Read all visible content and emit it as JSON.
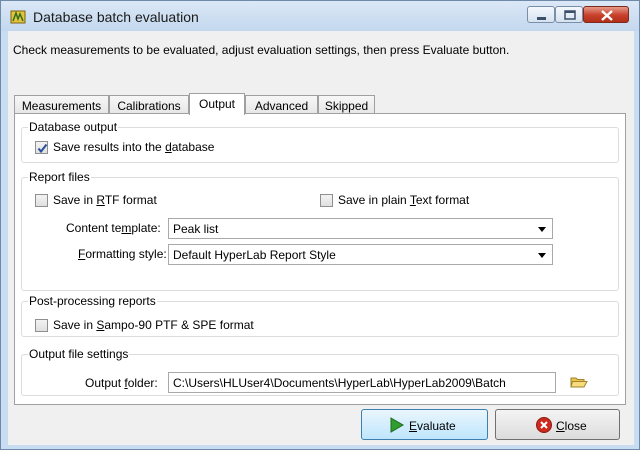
{
  "window": {
    "title": "Database batch evaluation",
    "instructions": "Check measurements to be evaluated, adjust evaluation settings, then press Evaluate button."
  },
  "tabs": [
    {
      "label": "Measurements",
      "active": false
    },
    {
      "label": "Calibrations",
      "active": false
    },
    {
      "label": "Output",
      "active": true
    },
    {
      "label": "Advanced",
      "active": false
    },
    {
      "label": "Skipped",
      "active": false
    }
  ],
  "database_output": {
    "group_label": "Database output",
    "save_results": {
      "pre": "Save results into the ",
      "accel": "d",
      "post": "atabase",
      "checked": true
    }
  },
  "report_files": {
    "group_label": "Report files",
    "save_rtf": {
      "pre": "Save in ",
      "accel": "R",
      "post": "TF format",
      "checked": false
    },
    "save_text": {
      "pre": "Save in plain ",
      "accel": "T",
      "post": "ext format",
      "checked": false
    },
    "content_template_label": {
      "pre": "Content te",
      "accel": "m",
      "post": "plate:"
    },
    "content_template_value": "Peak list",
    "formatting_style_label": {
      "pre": "",
      "accel": "F",
      "post": "ormatting style:"
    },
    "formatting_style_value": "Default HyperLab Report Style"
  },
  "post_processing": {
    "group_label": "Post-processing reports",
    "save_sampo": {
      "pre": "Save in ",
      "accel": "S",
      "post": "ampo-90 PTF & SPE format",
      "checked": false
    }
  },
  "output_file_settings": {
    "group_label": "Output file settings",
    "output_folder_label": {
      "pre": "Output ",
      "accel": "f",
      "post": "older:"
    },
    "output_folder_value": "C:\\Users\\HLUser4\\Documents\\HyperLab\\HyperLab2009\\Batch"
  },
  "buttons": {
    "evaluate": {
      "accel": "E",
      "post": "valuate"
    },
    "close": {
      "accel": "C",
      "post": "lose"
    }
  },
  "colors": {
    "title_bar": "#c9ddf2",
    "close_button": "#c7402a",
    "default_button": "#bee6fd",
    "play_icon": "#2f9e2f",
    "close_icon": "#cc2a1e",
    "folder_icon": "#e8c550"
  }
}
